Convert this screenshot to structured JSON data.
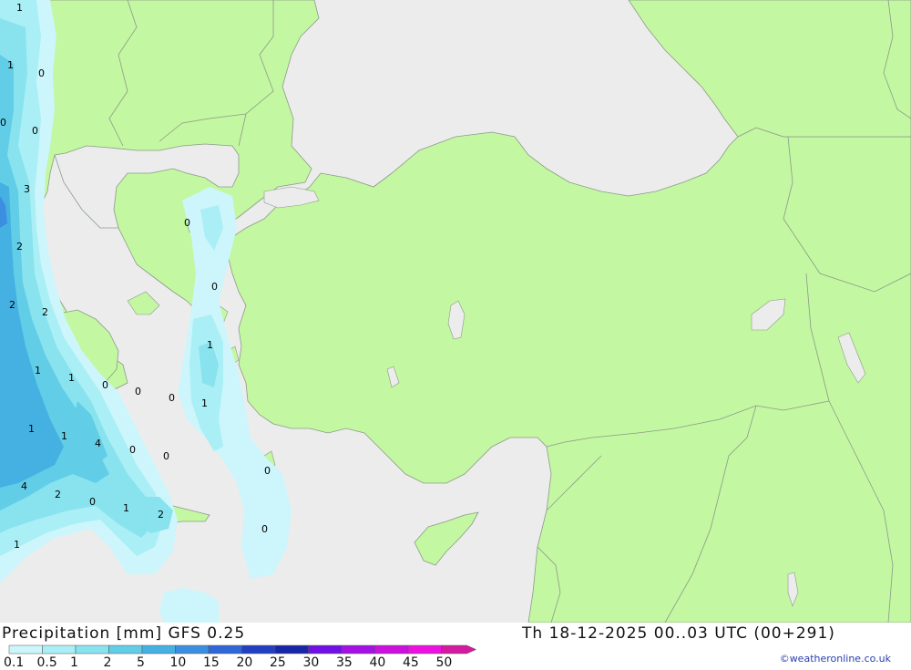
{
  "title_left": "Precipitation [mm] GFS 0.25",
  "title_right": "Th 18-12-2025 00..03 UTC (00+291)",
  "credit": "©weatheronline.co.uk",
  "legend": {
    "ticks": [
      "0.1",
      "0.5",
      "1",
      "2",
      "5",
      "10",
      "15",
      "20",
      "25",
      "30",
      "35",
      "40",
      "45",
      "50"
    ],
    "colors": [
      "#ccf6fb",
      "#aaeff5",
      "#88e3ee",
      "#62cde6",
      "#45b1e3",
      "#3c8fe0",
      "#2f67d6",
      "#233fc4",
      "#1826a8",
      "#7010e6",
      "#a510e6",
      "#cc10e0",
      "#ee10e0",
      "#d41aa0"
    ]
  },
  "map": {
    "land_color": "#c4f7a1",
    "sea_color": "#ececec",
    "labels": [
      {
        "text": "1"
      },
      {
        "text": "1"
      },
      {
        "text": "0"
      },
      {
        "text": "0"
      },
      {
        "text": "0"
      },
      {
        "text": "3"
      },
      {
        "text": "2"
      },
      {
        "text": "2"
      },
      {
        "text": "2"
      },
      {
        "text": "0"
      },
      {
        "text": "0"
      },
      {
        "text": "1"
      },
      {
        "text": "1"
      },
      {
        "text": "1"
      },
      {
        "text": "0"
      },
      {
        "text": "0"
      },
      {
        "text": "0"
      },
      {
        "text": "1"
      },
      {
        "text": "1"
      },
      {
        "text": "1"
      },
      {
        "text": "4"
      },
      {
        "text": "0"
      },
      {
        "text": "0"
      },
      {
        "text": "0"
      },
      {
        "text": "4"
      },
      {
        "text": "2"
      },
      {
        "text": "0"
      },
      {
        "text": "1"
      },
      {
        "text": "2"
      },
      {
        "text": "0"
      },
      {
        "text": "1"
      }
    ]
  }
}
